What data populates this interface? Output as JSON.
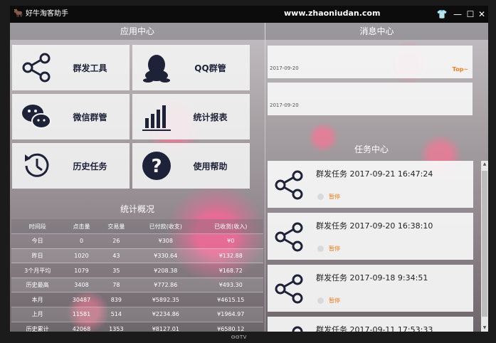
{
  "window": {
    "title": "好牛淘客助手",
    "site": "www.zhaoniudan.com",
    "btn_shirt": "👕",
    "btn_min": "—",
    "btn_max": "☐",
    "btn_close": "✕"
  },
  "app_center": {
    "header": "应用中心",
    "tiles": [
      {
        "label": "群发工具",
        "icon": "share-icon"
      },
      {
        "label": "QQ群管",
        "icon": "qq-icon"
      },
      {
        "label": "微信群管",
        "icon": "wechat-icon"
      },
      {
        "label": "统计报表",
        "icon": "bar-chart-icon"
      },
      {
        "label": "历史任务",
        "icon": "history-icon"
      },
      {
        "label": "使用帮助",
        "icon": "help-icon"
      }
    ]
  },
  "stats": {
    "title": "统计概况",
    "headers": [
      "时间段",
      "点击量",
      "交易量",
      "已付款(收支)",
      "已收货(收入)"
    ],
    "rows": [
      [
        "今日",
        "0",
        "26",
        "¥308",
        "¥0"
      ],
      [
        "昨日",
        "1020",
        "43",
        "¥330.64",
        "¥132.88"
      ],
      [
        "3个月平均",
        "1079",
        "35",
        "¥208.38",
        "¥168.72"
      ],
      [
        "历史最高",
        "3408",
        "78",
        "¥772.86",
        "¥493.30"
      ],
      [
        "本月",
        "30487",
        "839",
        "¥5892.35",
        "¥4615.15"
      ],
      [
        "上月",
        "11581",
        "514",
        "¥2234.86",
        "¥1964.97"
      ],
      [
        "历史累计",
        "42068",
        "1353",
        "¥8127.01",
        "¥6580.12"
      ]
    ]
  },
  "messages": {
    "header": "消息中心",
    "items": [
      {
        "date": "2017-09-20",
        "badge": "Top~"
      },
      {
        "date": "2017-09-20",
        "badge": ""
      }
    ]
  },
  "tasks": {
    "header": "任务中心",
    "items": [
      {
        "text": "群发任务 2017-09-21 16:47:24",
        "status": "暂停"
      },
      {
        "text": "群发任务 2017-09-20 16:38:10",
        "status": "暂停"
      },
      {
        "text": "群发任务 2017-09-18 9:34:51",
        "status": "暂停"
      },
      {
        "text": "群发任务 2017-09-11 17:53:33",
        "status": ""
      }
    ]
  },
  "scrollbar": {
    "up": "▲",
    "down": "▼"
  },
  "monitor": {
    "brand": "ᎾᎾTV"
  },
  "colors": {
    "accent": "#f07e1e",
    "icon": "#1e2238",
    "titlebar": "#0c0c0c"
  }
}
